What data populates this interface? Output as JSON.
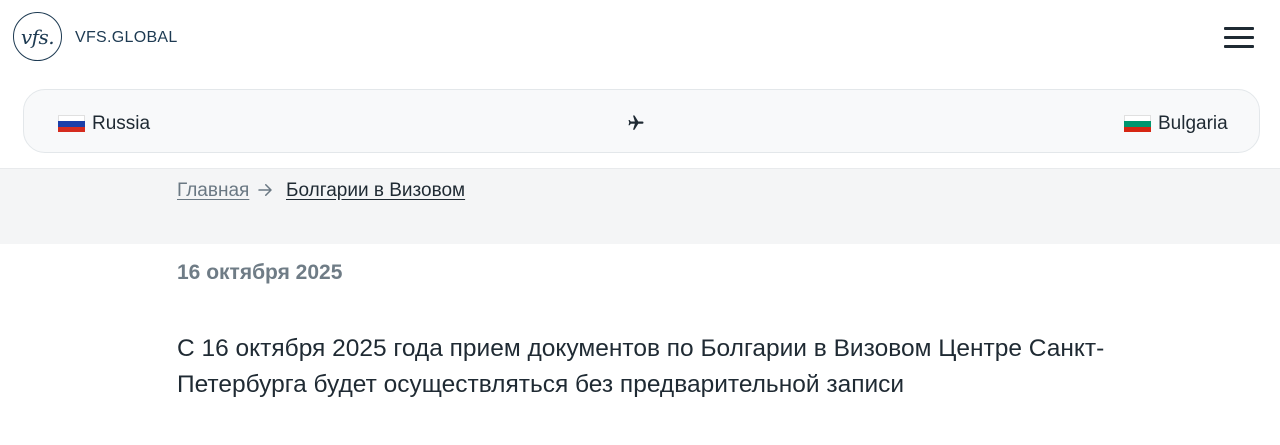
{
  "header": {
    "logo_mark": "vfs.",
    "logo_text": "VFS.GLOBAL"
  },
  "route": {
    "from_country": "Russia",
    "to_country": "Bulgaria"
  },
  "breadcrumb": {
    "home": "Главная",
    "current": "Болгарии в Визовом"
  },
  "article": {
    "date": "16 октября 2025",
    "headline": "С 16 октября 2025 года прием документов по Болгарии в Визовом Центре Санкт-Петербурга будет осуществляться без предварительной записи"
  },
  "colors": {
    "brand": "#1d3a52",
    "muted": "#6f7c86",
    "band": "#f4f5f6"
  },
  "icons": {
    "menu": "hamburger-menu-icon",
    "plane": "plane-icon",
    "arrow": "arrow-right-icon"
  }
}
